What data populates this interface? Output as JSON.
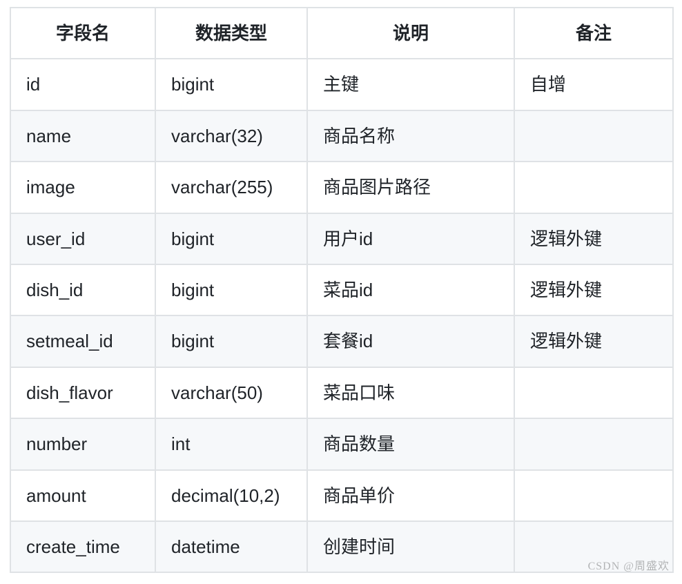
{
  "table": {
    "headers": [
      "字段名",
      "数据类型",
      "说明",
      "备注"
    ],
    "rows": [
      {
        "field": "id",
        "type": "bigint",
        "desc": "主键",
        "note": "自增"
      },
      {
        "field": "name",
        "type": "varchar(32)",
        "desc": "商品名称",
        "note": ""
      },
      {
        "field": "image",
        "type": "varchar(255)",
        "desc": "商品图片路径",
        "note": ""
      },
      {
        "field": "user_id",
        "type": "bigint",
        "desc": "用户id",
        "note": "逻辑外键"
      },
      {
        "field": "dish_id",
        "type": "bigint",
        "desc": "菜品id",
        "note": "逻辑外键"
      },
      {
        "field": "setmeal_id",
        "type": "bigint",
        "desc": "套餐id",
        "note": "逻辑外键"
      },
      {
        "field": "dish_flavor",
        "type": "varchar(50)",
        "desc": "菜品口味",
        "note": ""
      },
      {
        "field": "number",
        "type": "int",
        "desc": "商品数量",
        "note": ""
      },
      {
        "field": "amount",
        "type": "decimal(10,2)",
        "desc": "商品单价",
        "note": ""
      },
      {
        "field": "create_time",
        "type": "datetime",
        "desc": "创建时间",
        "note": ""
      }
    ]
  },
  "watermark": "CSDN @周盛欢"
}
